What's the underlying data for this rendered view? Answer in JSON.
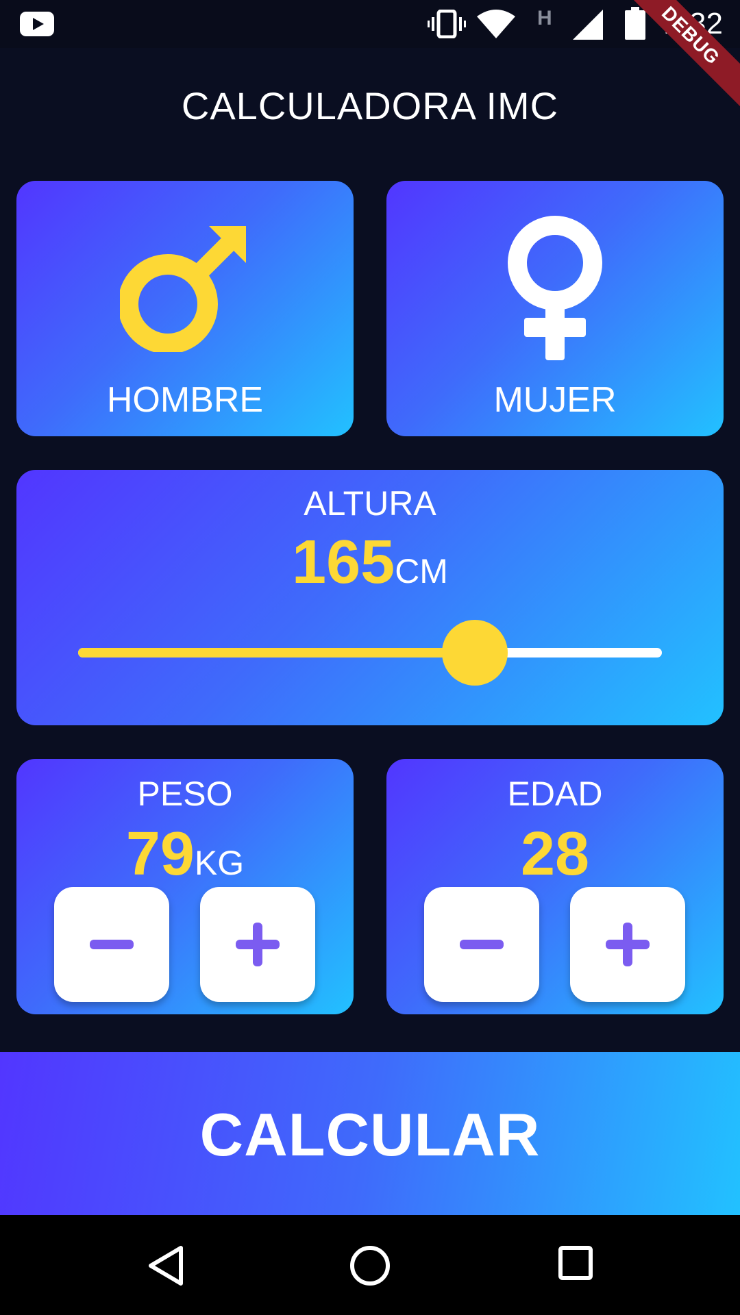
{
  "status_bar": {
    "time": "2:32",
    "network_letter": "H",
    "debug_banner": "DEBUG"
  },
  "app": {
    "title": "CALCULADORA IMC"
  },
  "gender": {
    "male_label": "HOMBRE",
    "female_label": "MUJER"
  },
  "height": {
    "label": "ALTURA",
    "value": "165",
    "unit": "CM",
    "slider_fraction": 0.68
  },
  "weight": {
    "label": "PESO",
    "value": "79",
    "unit": "KG"
  },
  "age": {
    "label": "EDAD",
    "value": "28"
  },
  "action": {
    "calculate_label": "CALCULAR"
  },
  "colors": {
    "background": "#0a0e21",
    "accent_yellow": "#fdd835",
    "card_gradient_start": "#5236ff",
    "card_gradient_end": "#22c1ff",
    "stepper_icon": "#7b5cf0"
  }
}
